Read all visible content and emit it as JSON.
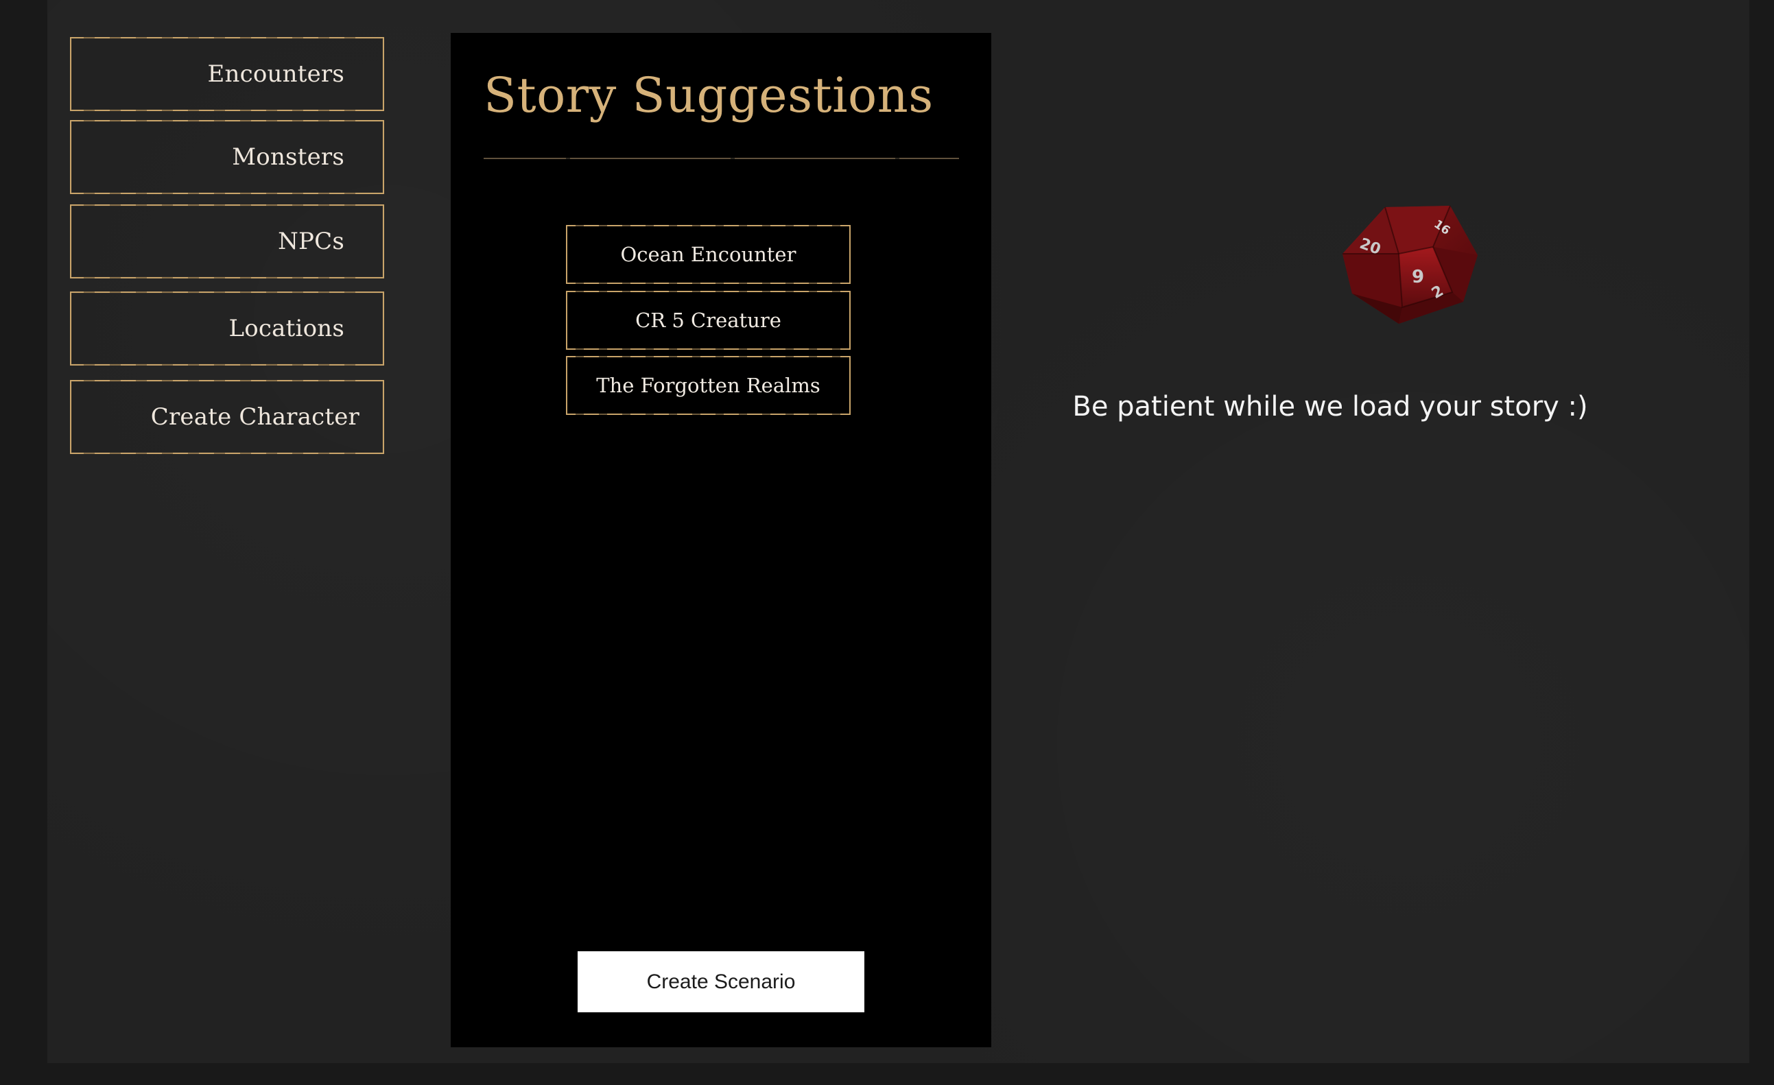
{
  "sidebar": {
    "items": [
      {
        "label": "Encounters"
      },
      {
        "label": "Monsters"
      },
      {
        "label": "NPCs"
      },
      {
        "label": "Locations"
      },
      {
        "label": "Create Character"
      }
    ]
  },
  "panel": {
    "title": "Story Suggestions",
    "suggestions": [
      {
        "label": "Ocean Encounter"
      },
      {
        "label": "CR 5 Creature"
      },
      {
        "label": "The Forgotten Realms"
      }
    ],
    "create_label": "Create Scenario"
  },
  "loading": {
    "message": "Be patient while we load your story :)",
    "dice_faces": [
      "20",
      "9",
      "16",
      "2"
    ],
    "dice_color": "#6b0f12"
  },
  "colors": {
    "accent": "#c9a46a",
    "title": "#d6b27a",
    "background": "#222222",
    "panel": "#000000"
  }
}
